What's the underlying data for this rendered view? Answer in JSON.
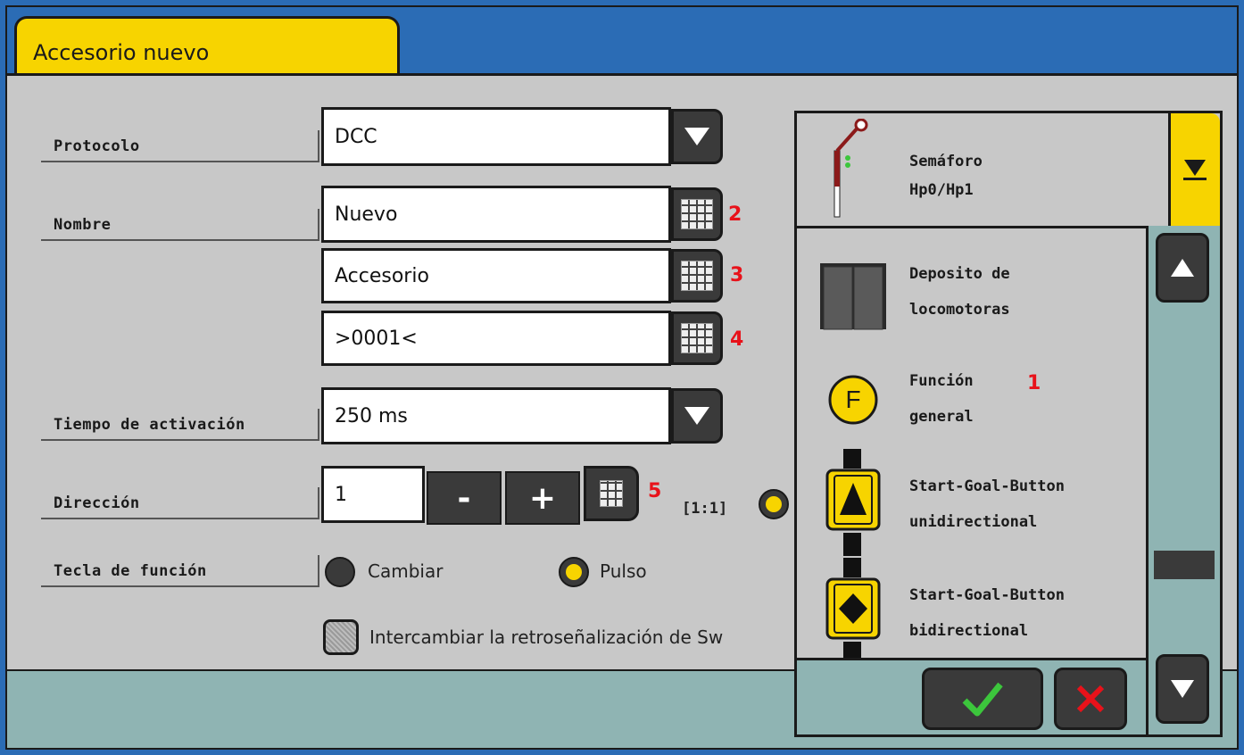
{
  "window": {
    "title": "Accesorio nuevo"
  },
  "form": {
    "protocol_label": "Protocolo",
    "protocol_value": "DCC",
    "name_label": "Nombre",
    "name_line1": "Nuevo",
    "name_line2": "Accesorio",
    "name_line3": ">0001<",
    "activation_label": "Tiempo de activación",
    "activation_value": "250 ms",
    "direction_label": "Dirección",
    "direction_value": "1",
    "minus_label": "-",
    "plus_label": "+",
    "ratio_label": "[1:1]",
    "function_key_label": "Tecla de función",
    "option_switch": "Cambiar",
    "option_pulse": "Pulso",
    "selected_option": "Pulso",
    "swap_checkbox_label": "Intercambiar la retroseñalización de Sw",
    "swap_checked": false
  },
  "annotations": {
    "n1": "1",
    "n2": "2",
    "n3": "3",
    "n4": "4",
    "n5": "5"
  },
  "accessory_picker": {
    "selected": {
      "line1": "Semáforo",
      "line2": "Hp0/Hp1",
      "icon": "semaphore-signal-icon"
    },
    "items": [
      {
        "line1": "Deposito de",
        "line2": "locomotoras",
        "icon": "locomotive-shed-icon"
      },
      {
        "line1": "Función",
        "line2": "general",
        "icon": "function-f-icon"
      },
      {
        "line1": "Start-Goal-Button",
        "line2": "unidirectional",
        "icon": "start-goal-uni-icon"
      },
      {
        "line1": "Start-Goal-Button",
        "line2": "bidirectional",
        "icon": "start-goal-bi-icon"
      }
    ],
    "scroll_position": 0.6
  },
  "colors": {
    "accent": "#f7d400",
    "header": "#2b6cb5",
    "panel": "#c8c8c8",
    "footer": "#8fb4b3",
    "annotation": "#e8121a",
    "confirm": "#3cc63c",
    "cancel": "#e8121a"
  }
}
